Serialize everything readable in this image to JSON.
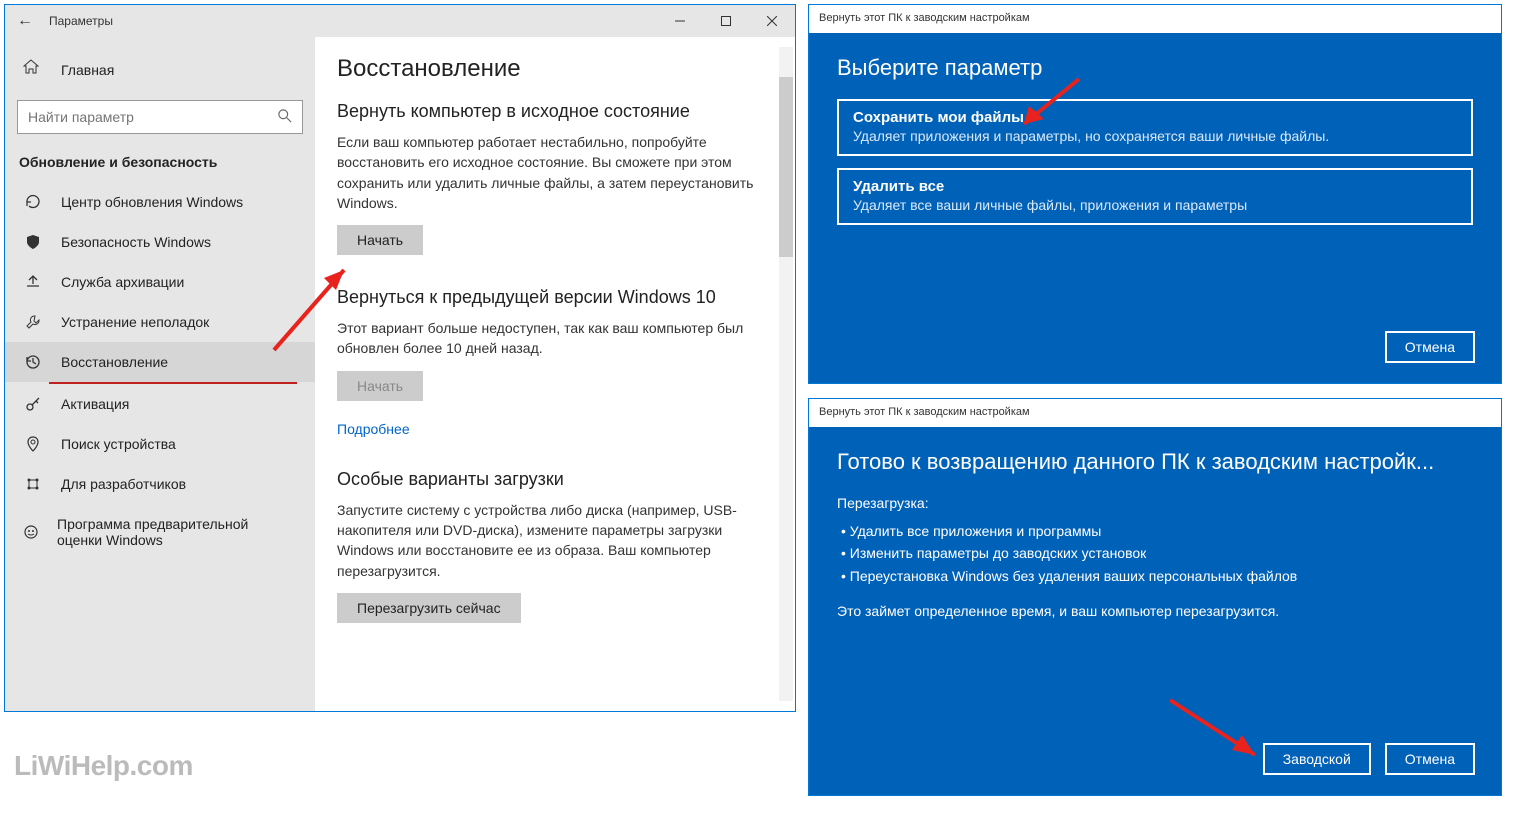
{
  "settings": {
    "window_title": "Параметры",
    "home": "Главная",
    "search_placeholder": "Найти параметр",
    "section": "Обновление и безопасность",
    "nav": [
      {
        "label": "Центр обновления Windows"
      },
      {
        "label": "Безопасность Windows"
      },
      {
        "label": "Служба архивации"
      },
      {
        "label": "Устранение неполадок"
      },
      {
        "label": "Восстановление"
      },
      {
        "label": "Активация"
      },
      {
        "label": "Поиск устройства"
      },
      {
        "label": "Для разработчиков"
      },
      {
        "label": "Программа предварительной оценки Windows"
      }
    ],
    "content": {
      "heading": "Восстановление",
      "sec1_title": "Вернуть компьютер в исходное состояние",
      "sec1_body": "Если ваш компьютер работает нестабильно, попробуйте восстановить его исходное состояние. Вы сможете при этом сохранить или удалить личные файлы, а затем переустановить Windows.",
      "sec1_btn": "Начать",
      "sec2_title": "Вернуться к предыдущей версии Windows 10",
      "sec2_body": "Этот вариант больше недоступен, так как ваш компьютер был обновлен более 10 дней назад.",
      "sec2_btn": "Начать",
      "sec2_link": "Подробнее",
      "sec3_title": "Особые варианты загрузки",
      "sec3_body": "Запустите систему с устройства либо диска (например, USB-накопителя или DVD-диска), измените параметры загрузки Windows или восстановите ее из образа. Ваш компьютер перезагрузится.",
      "sec3_btn": "Перезагрузить сейчас"
    }
  },
  "dialog1": {
    "title": "Вернуть этот ПК к заводским настройкам",
    "heading": "Выберите параметр",
    "options": [
      {
        "title": "Сохранить мои файлы",
        "desc": "Удаляет приложения и параметры, но сохраняется ваши личные файлы."
      },
      {
        "title": "Удалить все",
        "desc": "Удаляет все ваши личные файлы, приложения и параметры"
      }
    ],
    "cancel": "Отмена"
  },
  "dialog2": {
    "title": "Вернуть этот ПК к заводским настройкам",
    "heading": "Готово к возвращению данного ПК к заводским настройк...",
    "sub": "Перезагрузка:",
    "bullets": [
      "• Удалить все приложения и программы",
      "• Изменить параметры до заводских установок",
      "• Переустановка Windows без удаления ваших персональных файлов"
    ],
    "footer_text": "Это займет определенное время, и ваш компьютер перезагрузится.",
    "primary": "Заводской",
    "cancel": "Отмена"
  },
  "watermark": "LiWiHelp.com"
}
